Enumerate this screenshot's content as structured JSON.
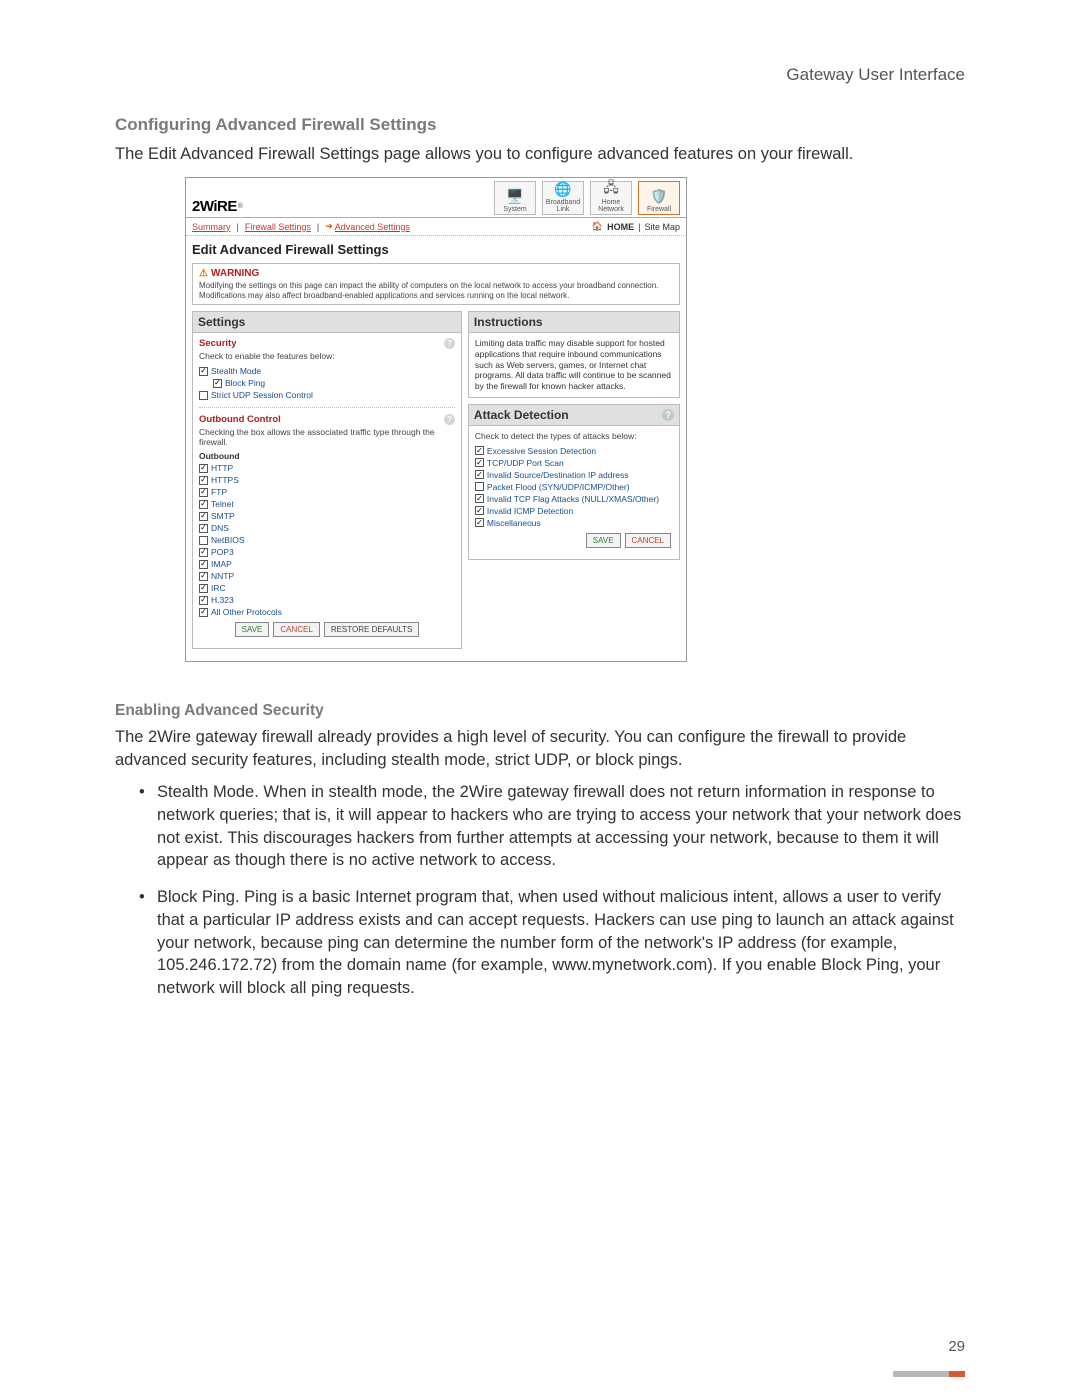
{
  "header": {
    "running_title": "Gateway User Interface"
  },
  "section1": {
    "title": "Configuring Advanced Firewall Settings",
    "intro": "The Edit Advanced Firewall Settings page allows you to configure advanced features on your firewall."
  },
  "screenshot": {
    "logo_text": "2WiRE",
    "nav": {
      "system": "System",
      "broadband": "Broadband Link",
      "home_network": "Home Network",
      "firewall": "Firewall"
    },
    "tabs": {
      "summary": "Summary",
      "firewall_settings": "Firewall Settings",
      "advanced_settings": "Advanced Settings",
      "home": "HOME",
      "sitemap": "Site Map"
    },
    "page_title": "Edit Advanced Firewall Settings",
    "warning": {
      "title": "WARNING",
      "body": "Modifying the settings on this page can impact the ability of computers on the local network to access your broadband connection. Modifications may also affect broadband-enabled applications and services running on the local network."
    },
    "settings": {
      "panel_title": "Settings",
      "security": {
        "heading": "Security",
        "desc": "Check to enable the features below:",
        "items": [
          {
            "label": "Stealth Mode",
            "checked": true,
            "indent": 0
          },
          {
            "label": "Block Ping",
            "checked": true,
            "indent": 1
          },
          {
            "label": "Strict UDP Session Control",
            "checked": false,
            "indent": 0
          }
        ]
      },
      "outbound": {
        "heading": "Outbound Control",
        "desc": "Checking the box allows the associated traffic type through the firewall.",
        "group_label": "Outbound",
        "items": [
          {
            "label": "HTTP",
            "checked": true
          },
          {
            "label": "HTTPS",
            "checked": true
          },
          {
            "label": "FTP",
            "checked": true
          },
          {
            "label": "Telnet",
            "checked": true
          },
          {
            "label": "SMTP",
            "checked": true
          },
          {
            "label": "DNS",
            "checked": true
          },
          {
            "label": "NetBIOS",
            "checked": false
          },
          {
            "label": "POP3",
            "checked": true
          },
          {
            "label": "IMAP",
            "checked": true
          },
          {
            "label": "NNTP",
            "checked": true
          },
          {
            "label": "IRC",
            "checked": true
          },
          {
            "label": "H.323",
            "checked": true
          },
          {
            "label": "All Other Protocols",
            "checked": true
          }
        ]
      },
      "buttons": {
        "save": "SAVE",
        "cancel": "CANCEL",
        "restore": "RESTORE DEFAULTS"
      }
    },
    "instructions": {
      "panel_title": "Instructions",
      "body": "Limiting data traffic may disable support for hosted applications that require inbound communications such as Web servers, games, or Internet chat programs. All data traffic will continue to be scanned by the firewall for known hacker attacks."
    },
    "attack": {
      "panel_title": "Attack Detection",
      "desc": "Check to detect the types of attacks below:",
      "items": [
        {
          "label": "Excessive Session Detection",
          "checked": true
        },
        {
          "label": "TCP/UDP Port Scan",
          "checked": true
        },
        {
          "label": "Invalid Source/Destination IP address",
          "checked": true
        },
        {
          "label": "Packet Flood (SYN/UDP/ICMP/Other)",
          "checked": false
        },
        {
          "label": "Invalid TCP Flag Attacks (NULL/XMAS/Other)",
          "checked": true
        },
        {
          "label": "Invalid ICMP Detection",
          "checked": true
        },
        {
          "label": "Miscellaneous",
          "checked": true
        }
      ],
      "buttons": {
        "save": "SAVE",
        "cancel": "CANCEL"
      }
    }
  },
  "section2": {
    "title": "Enabling Advanced Security",
    "intro": "The 2Wire gateway firewall already provides a high level of security. You can configure the firewall to provide advanced security features, including stealth mode, strict UDP, or block pings.",
    "bullets": [
      "Stealth Mode. When in stealth mode, the 2Wire gateway firewall does not return information in response to network queries; that is, it will appear to hackers who are trying to access your network that your network does not exist. This discourages hackers from further attempts at accessing your network, because to them it will appear as though there is no active network to access.",
      "Block Ping. Ping is a basic Internet program that, when used without malicious intent, allows a user to verify that a particular IP address exists and can accept requests. Hackers can use ping to launch an attack against your network, because ping can determine the number form of the network's IP address (for example, 105.246.172.72) from the domain name (for example, www.mynetwork.com). If you enable Block Ping, your network will block all ping requests."
    ]
  },
  "page_number": "29"
}
